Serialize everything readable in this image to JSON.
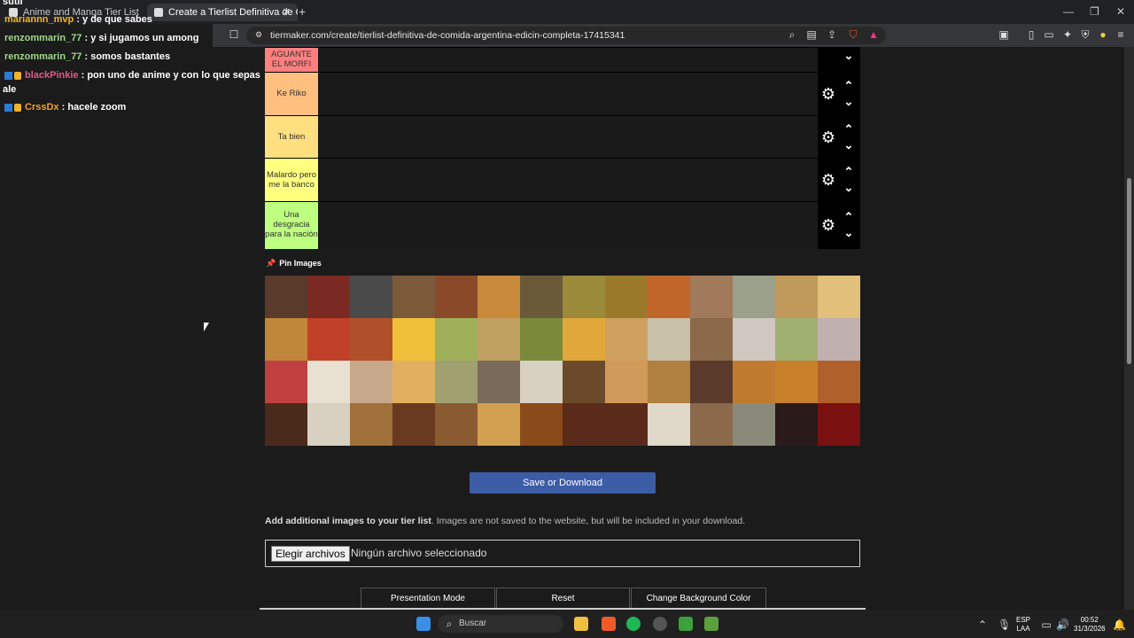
{
  "browser": {
    "tabs": [
      {
        "title": "Anime and Manga Tier List Template"
      },
      {
        "title": "Create a Tierlist Definitiva de Co"
      }
    ],
    "new_tab_glyph": "+",
    "url": "tiermaker.com/create/tierlist-definitiva-de-comida-argentina-edicin-completa-17415341"
  },
  "chat": {
    "messages": [
      {
        "user": "",
        "text": "sutil"
      },
      {
        "user": "mariannn_mvp",
        "text": ": y de que sabes"
      },
      {
        "user": "renzommarin_77",
        "text": ": y si jugamos un among"
      },
      {
        "user": "renzommarin_77",
        "text": ": somos bastantes"
      },
      {
        "user": "blackPinkie",
        "text": ": pon uno de anime y con lo que sepas"
      },
      {
        "user": "",
        "text": "ale"
      },
      {
        "user": "CrssDx",
        "text": ": hacele zoom"
      }
    ]
  },
  "tiers": [
    {
      "label": "AGUANTE EL MORFI",
      "color": "#ff7f7f"
    },
    {
      "label": "Ke Riko",
      "color": "#ffbf7f"
    },
    {
      "label": "Ta bien",
      "color": "#ffdf7f"
    },
    {
      "label": "Malardo pero me la banco",
      "color": "#ffff7f"
    },
    {
      "label": "Una desgracia para la nación",
      "color": "#bfff7f"
    }
  ],
  "pin_label": "Pin Images",
  "save_label": "Save or Download",
  "add_images": {
    "bold": "Add additional images to your tier list",
    "rest": ". Images are not saved to the website, but will be included in your download."
  },
  "file_input": {
    "button": "Elegir archivos",
    "status": "Ningún archivo seleccionado"
  },
  "bottom_buttons": [
    "Presentation Mode",
    "Reset",
    "Change Background Color"
  ],
  "taskbar": {
    "search_placeholder": "Buscar",
    "lang": "ESP",
    "layout": "LAA",
    "time": "00:52",
    "date": "31/3/2026"
  },
  "tile_colors": [
    "#5a3a2a",
    "#7a2a22",
    "#4a4a4a",
    "#7b5a3a",
    "#8a4a2a",
    "#c88a3a",
    "#6a5a3a",
    "#9a8a3a",
    "#9a7a2a",
    "#c0662a",
    "#a07a5a",
    "#9aa08a",
    "#c09a5a",
    "#e0c07a",
    "#c0873a",
    "#c0402a",
    "#b0502a",
    "#f0c03a",
    "#a0b05a",
    "#c0a060",
    "#7a8a3a",
    "#e0a83a",
    "#d0a060",
    "#c8c0a8",
    "#8a6a4a",
    "#d0c8c0",
    "#a0b070",
    "#c0b0b0",
    "#c04040",
    "#e8e0d0",
    "#c8a88a",
    "#e0b060",
    "#a0a070",
    "#7a6a5a",
    "#d8d0c0",
    "#6a4a2a",
    "#d09a5a",
    "#b08040",
    "#5a3a2a",
    "#c07a30",
    "#c8802a",
    "#b0602a",
    "#4a2a1a",
    "#d8d0c0",
    "#a0703a",
    "#6a3a20",
    "#8a5a30",
    "#d0a050",
    "#8a4a1a",
    "#5a2a1a",
    "#5a2a1a",
    "#e0d8c8",
    "#8a6a4a",
    "#8a8a7a",
    "#2a1a1a",
    "#7a1010"
  ]
}
